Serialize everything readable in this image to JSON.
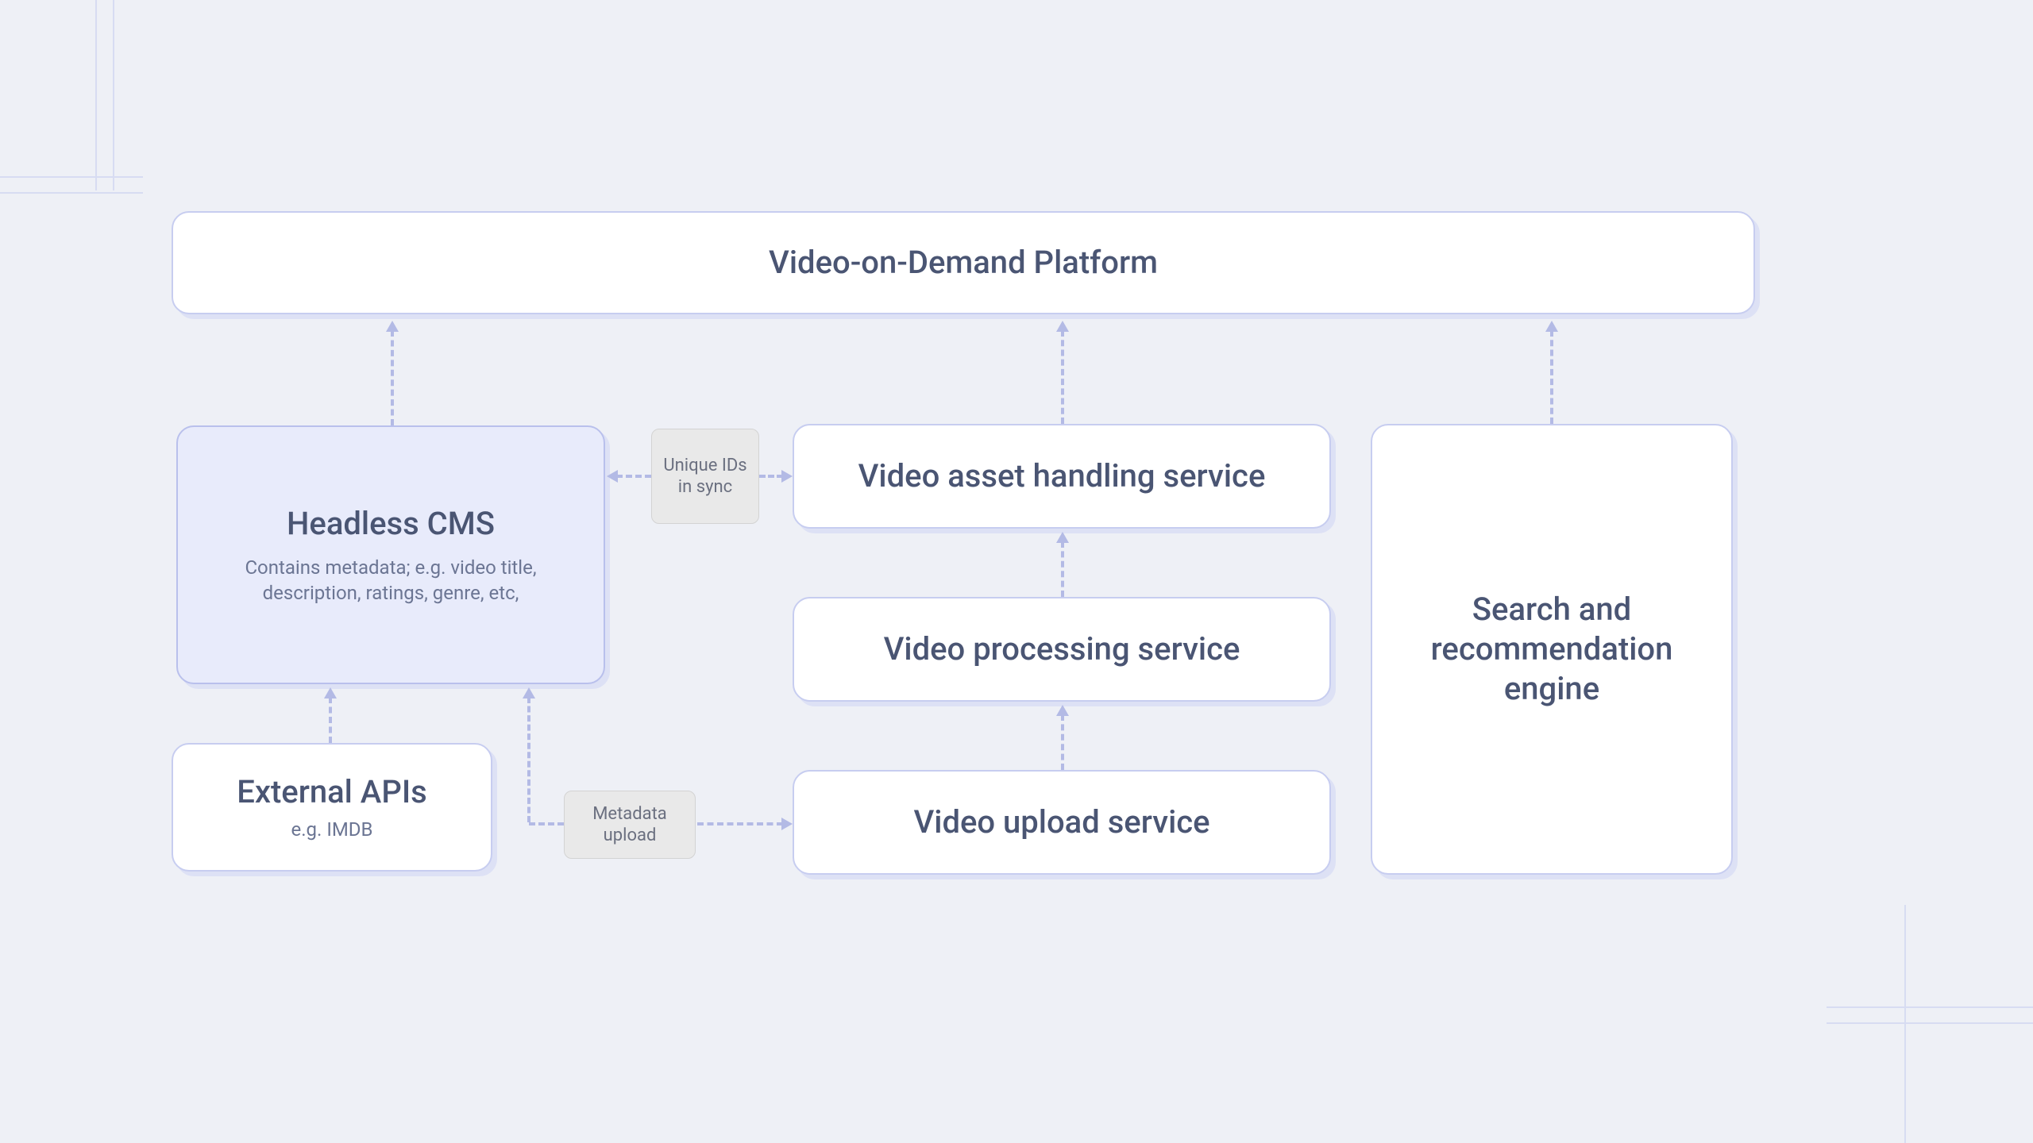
{
  "platform": {
    "title": "Video-on-Demand Platform"
  },
  "cms": {
    "title": "Headless CMS",
    "subtitle": "Contains metadata; e.g. video title, description, ratings, genre, etc,"
  },
  "external": {
    "title": "External APIs",
    "subtitle": "e.g. IMDB"
  },
  "asset": {
    "title": "Video asset handling service"
  },
  "processing": {
    "title": "Video processing service"
  },
  "upload": {
    "title": "Video upload service"
  },
  "search": {
    "title": "Search and recommendation engine"
  },
  "labels": {
    "sync": "Unique IDs in sync",
    "metadata": "Metadata upload"
  }
}
